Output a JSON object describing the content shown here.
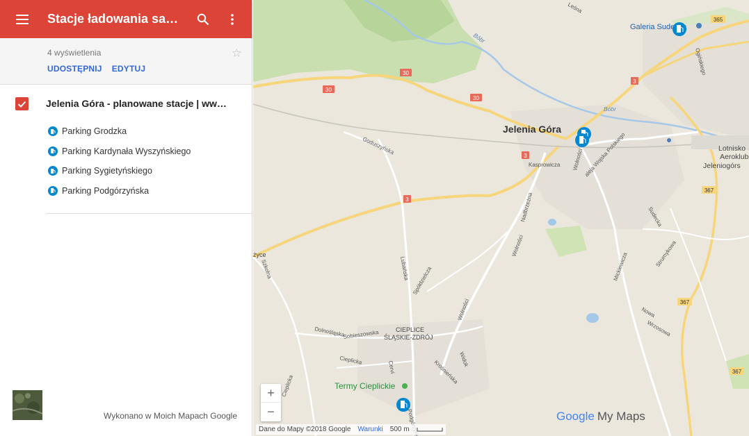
{
  "header": {
    "title": "Stacje ładowania samo..."
  },
  "map_info": {
    "views": "4 wyświetlenia",
    "share_label": "UDOSTĘPNIJ",
    "edit_label": "EDYTUJ"
  },
  "layer": {
    "title": "Jelenia Góra - planowane stacje | www....",
    "places": [
      {
        "name": "Parking Grodzka"
      },
      {
        "name": "Parking Kardynała Wyszyńskiego"
      },
      {
        "name": "Parking Sygietyńskiego"
      },
      {
        "name": "Parking Podgórzyńska"
      }
    ]
  },
  "footer": {
    "credit": "Wykonano w Moich Mapach Google"
  },
  "map": {
    "labels": {
      "city": "Jelenia Góra",
      "galeria": "Galeria Sudecka",
      "lotnisko1": "Lotnisko",
      "lotnisko2": "Aeroklub",
      "lotnisko3": "Jeleniogórs",
      "cieplice1": "CIEPLICE",
      "cieplice2": "ŚLĄSKIE-ZDRÓJ",
      "termy": "Termy Cieplickie",
      "bobr1": "Bóbr",
      "bobr2": "Bóbr",
      "lesna": "Leśna",
      "goduszynska": "Goduszyńska",
      "lubanska": "Lubańska",
      "spoldzielcza": "Spółdzielcza",
      "wolnosci1": "Wolności",
      "wolnosci2": "Wolności",
      "nadbrzezna": "Nadbrzeżna",
      "kasprowicza": "Kasprowicza",
      "wolnosci3": "Wolności",
      "wojska": "aleja Wojska Polskiego",
      "sudecka": "Sudecka",
      "mickiewicza": "Mickiewicza",
      "strumykowa": "Strumykowa",
      "nowa": "Nowa",
      "wrzosowa": "Wrzosowa",
      "dolnoslaska": "Dolnośląska",
      "sobieszowska": "Sobieszowska",
      "cieplicka": "Cieplicka",
      "cervi": "Cervi",
      "krosnienska": "Krośnieńska",
      "widok": "Widok",
      "szkolna": "Szkolna",
      "cieplicka2": "Cieplicka",
      "podgorzynska": "Podgórzyńska",
      "zyce": "życe",
      "ogińskiego": "Ogińskiego"
    },
    "road_numbers": {
      "r30a": "30",
      "r30b": "30",
      "r30c": "30",
      "r3a": "3",
      "r3b": "3",
      "r3c": "3",
      "r365": "365",
      "r367a": "367",
      "r367b": "367",
      "r367c": "367"
    },
    "attribution": "Dane do Mapy ©2018 Google",
    "terms": "Warunki",
    "scale": "500 m",
    "brand_google": "Google",
    "brand_mymaps": "My Maps"
  }
}
